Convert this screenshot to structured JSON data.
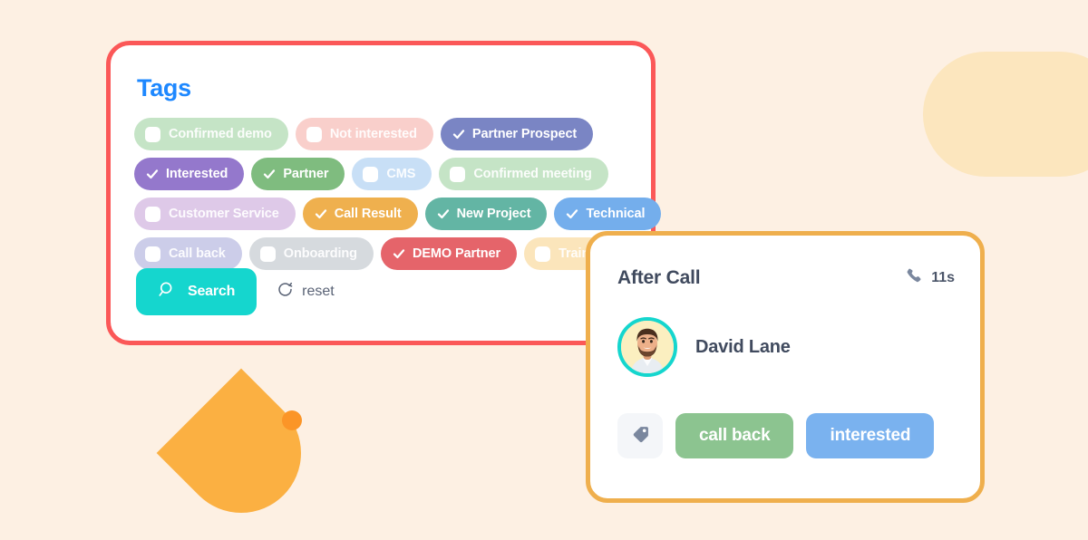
{
  "theme": {
    "page_background": "#FDF0E3",
    "tags_card_border": "#FB5858",
    "after_call_card_border": "#EFAF4D",
    "tags_title_color": "#1E88FF",
    "search_button_color": "#15D6CE",
    "accent_teal": "#15D6CE",
    "decor_pill_color": "#FCE6BE",
    "decor_semicircle_color": "#FBB042",
    "decor_dot_color": "#FB9527"
  },
  "tags_panel": {
    "title": "Tags",
    "rows": [
      [
        {
          "label": "Confirmed demo",
          "selected": false,
          "color": "#C5E4C6"
        },
        {
          "label": "Not interested",
          "selected": false,
          "color": "#F9CFCB"
        },
        {
          "label": "Partner Prospect",
          "selected": true,
          "color": "#7A85C4"
        }
      ],
      [
        {
          "label": "Interested",
          "selected": true,
          "color": "#9478CC"
        },
        {
          "label": "Partner",
          "selected": true,
          "color": "#7FBC7F"
        },
        {
          "label": "CMS",
          "selected": false,
          "color": "#C8DFF6"
        },
        {
          "label": "Confirmed meeting",
          "selected": false,
          "color": "#C5E4C6"
        }
      ],
      [
        {
          "label": "Customer Service",
          "selected": false,
          "color": "#DEC9E8"
        },
        {
          "label": "Call Result",
          "selected": true,
          "color": "#EFB04E"
        },
        {
          "label": "New Project",
          "selected": true,
          "color": "#63B5A4"
        },
        {
          "label": "Technical",
          "selected": true,
          "color": "#74AEEC"
        }
      ],
      [
        {
          "label": "Call back",
          "selected": false,
          "color": "#CCCDE9"
        },
        {
          "label": "Onboarding",
          "selected": false,
          "color": "#D6DADE"
        },
        {
          "label": "DEMO Partner",
          "selected": true,
          "color": "#E5646A"
        },
        {
          "label": "Training",
          "selected": false,
          "color": "#FBE5BB"
        }
      ]
    ],
    "search_label": "Search",
    "search_icon": "search-icon",
    "reset_label": "reset",
    "reset_icon": "refresh-icon"
  },
  "after_call": {
    "title": "After Call",
    "duration": "11s",
    "phone_icon": "phone-icon",
    "contact_name": "David Lane",
    "avatar_icon": "avatar-photo",
    "tag_button_icon": "tag-icon",
    "buttons": [
      {
        "label": "call back",
        "color": "#8CC490"
      },
      {
        "label": "interested",
        "color": "#7AB2EF"
      }
    ]
  }
}
